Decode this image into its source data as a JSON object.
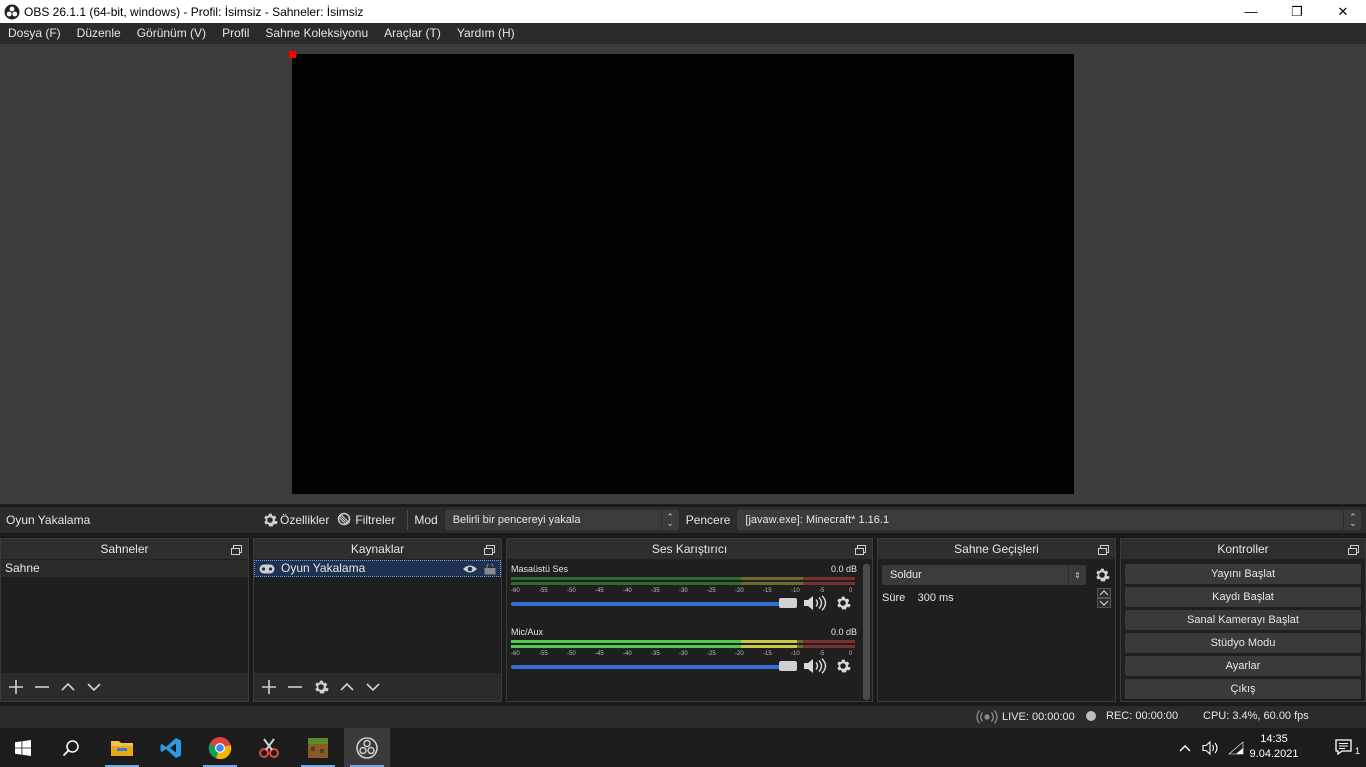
{
  "window": {
    "title": "OBS 26.1.1 (64-bit, windows) - Profil: İsimsiz - Sahneler: İsimsiz",
    "minimize": "—",
    "restore": "❐",
    "close": "✕"
  },
  "menu": [
    "Dosya (F)",
    "Düzenle",
    "Görünüm (V)",
    "Profil",
    "Sahne Koleksiyonu",
    "Araçlar (T)",
    "Yardım (H)"
  ],
  "context": {
    "source_name": "Oyun Yakalama",
    "properties_label": "Özellikler",
    "filters_label": "Filtreler",
    "mode_label": "Mod",
    "mode_value": "Belirli bir pencereyi yakala",
    "window_label": "Pencere",
    "window_value": "[javaw.exe]: Minecraft* 1.16.1"
  },
  "scenes": {
    "title": "Sahneler",
    "items": [
      "Sahne"
    ]
  },
  "sources": {
    "title": "Kaynaklar",
    "items": [
      "Oyun Yakalama"
    ]
  },
  "mixer": {
    "title": "Ses Karıştırıcı",
    "channels": [
      {
        "name": "Masaüstü Ses",
        "db": "0.0 dB",
        "level": 0
      },
      {
        "name": "Mic/Aux",
        "db": "0.0 dB",
        "level": 0.85
      }
    ],
    "ticks": [
      "-60",
      "-55",
      "-50",
      "-45",
      "-40",
      "-35",
      "-30",
      "-25",
      "-20",
      "-15",
      "-10",
      "-5",
      "0"
    ]
  },
  "transitions": {
    "title": "Sahne Geçişleri",
    "selected": "Soldur",
    "duration_label": "Süre",
    "duration_value": "300 ms"
  },
  "controls": {
    "title": "Kontroller",
    "buttons": [
      "Yayını Başlat",
      "Kaydı Başlat",
      "Sanal Kamerayı Başlat",
      "Stüdyo Modu",
      "Ayarlar",
      "Çıkış"
    ]
  },
  "status": {
    "live": "LIVE: 00:00:00",
    "rec": "REC: 00:00:00",
    "cpu": "CPU: 3.4%, 60.00 fps"
  },
  "taskbar": {
    "time": "14:35",
    "date": "9.04.2021",
    "notification_count": "1"
  },
  "colors": {
    "accent": "#2f6fd6",
    "meter_green": "#4fc94f",
    "meter_yellow": "#c8c84a",
    "meter_red": "#c84a4a",
    "preview_handle": "#ff0000"
  }
}
